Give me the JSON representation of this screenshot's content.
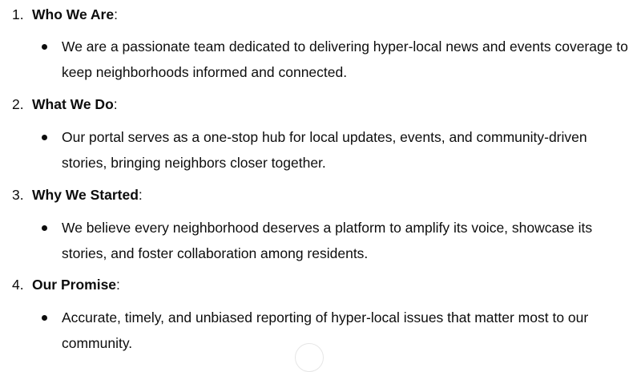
{
  "sections": [
    {
      "number": "1.",
      "title": "Who We Are",
      "colon": ":",
      "bullet_lines": [
        "We are a passionate team dedicated to delivering hyper-local news and events coverage to",
        "keep neighborhoods informed and connected."
      ]
    },
    {
      "number": "2.",
      "title": "What We Do",
      "colon": ":",
      "bullet_lines": [
        "Our portal serves as a one-stop hub for local updates, events, and community-driven",
        "stories, bringing neighbors closer together."
      ]
    },
    {
      "number": "3.",
      "title": "Why We Started",
      "colon": ":",
      "bullet_lines": [
        "We believe every neighborhood deserves a platform to amplify its voice, showcase its",
        "stories, and foster collaboration among residents."
      ]
    },
    {
      "number": "4.",
      "title": "Our Promise",
      "colon": ":",
      "bullet_lines": [
        "Accurate, timely, and unbiased reporting of hyper-local issues that matter most to our",
        "community."
      ]
    }
  ]
}
